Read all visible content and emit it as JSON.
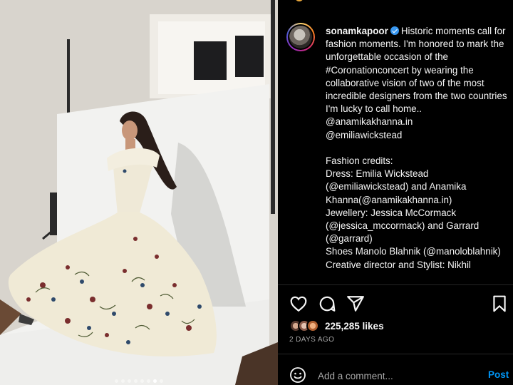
{
  "post": {
    "photo_alt": "",
    "carousel": {
      "total": 8,
      "active": 7
    }
  },
  "caption": {
    "username": "sonamkapoor",
    "verified_icon": "verified-badge-icon",
    "text_after_username": "Historic moments call for fashion moments. I'm honored to mark the unforgettable occasion of the #Coronationconcert by wearing the collaborative vision of two of the most incredible designers from the two countries I'm lucky to call home..",
    "mention_1": "@anamikakhanna.in",
    "mention_2": "@emiliawickstead",
    "credits_heading": "Fashion credits:",
    "credit_dress": "Dress: Emilia Wickstead (@emiliawickstead) and Anamika Khanna(@anamikakhanna.in)",
    "credit_jewellery": "Jewellery: Jessica McCormack (@jessica_mccormack) and Garrard (@garrard)",
    "credit_shoes": "Shoes Manolo Blahnik (@manoloblahnik)",
    "credit_creative": "Creative director and Stylist: Nikhil"
  },
  "actions": {
    "like_icon": "heart-icon",
    "comment_icon": "comment-icon",
    "share_icon": "send-icon",
    "save_icon": "bookmark-icon"
  },
  "likes": {
    "count_label": "225,285 likes"
  },
  "date": "2 DAYS AGO",
  "comment": {
    "placeholder": "Add a comment...",
    "post_label": "Post",
    "emoji_icon": "emoji-smile-icon"
  },
  "colors": {
    "accent_blue": "#0095f6",
    "background": "#000000",
    "text": "#f5f5f5",
    "muted": "#a8a8a8"
  }
}
